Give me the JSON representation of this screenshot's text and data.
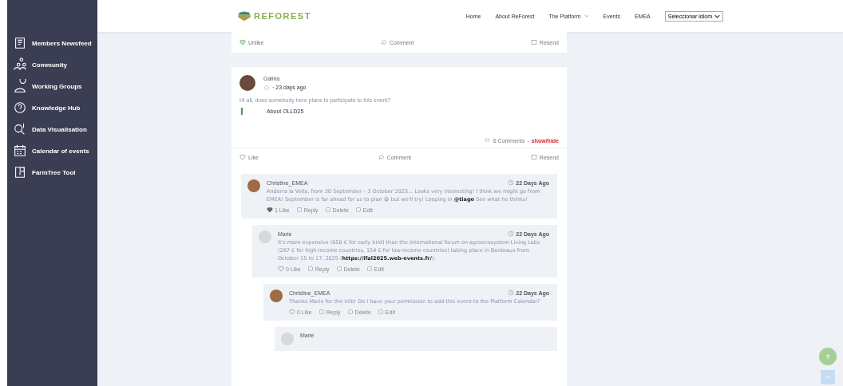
{
  "sidebar": {
    "items": [
      {
        "label": "Members Newsfeed"
      },
      {
        "label": "Community"
      },
      {
        "label": "Working Groups"
      },
      {
        "label": "Knowledge Hub"
      },
      {
        "label": "Data Visualisation"
      },
      {
        "label": "Calendar of events"
      },
      {
        "label": "FarmTree Tool"
      }
    ]
  },
  "header": {
    "logo": "REFOREST",
    "nav": [
      {
        "label": "Home",
        "dropdown": false
      },
      {
        "label": "About ReForest",
        "dropdown": false
      },
      {
        "label": "The Platform",
        "dropdown": true
      },
      {
        "label": "Events",
        "dropdown": false
      },
      {
        "label": "EMEA",
        "dropdown": false
      }
    ],
    "language_select": {
      "value": "Seleccionar idiom"
    }
  },
  "previous_post": {
    "actions": [
      {
        "label": "Unlike",
        "kind": "like",
        "liked": true
      },
      {
        "label": "Comment",
        "kind": "comment"
      },
      {
        "label": "Resend",
        "kind": "resend"
      }
    ]
  },
  "post": {
    "author": "Galina",
    "time": "· 23 days ago",
    "text": "Hi all, does somebody here plans to participate to this event?",
    "link_card": "About OLLD25",
    "comments_count": "6 Comments",
    "separator": "-",
    "toggle": "show/hide",
    "actions": [
      {
        "label": "Like",
        "kind": "like",
        "liked": false
      },
      {
        "label": "Comment",
        "kind": "comment"
      },
      {
        "label": "Resend",
        "kind": "resend"
      }
    ],
    "comments": [
      {
        "author": "Christine_EMEA",
        "has_photo": true,
        "time": "22 Days Ago",
        "text": "Andorra la Vella, from 30 September – 3 October 2025... Looks very interesting! I think we might go from EMEA! September is far ahead for us to plan 😀 but we'll try! Looping in **@tiago** See what he thinks!",
        "likes": "1 Like",
        "liked": true,
        "actions": [
          "Reply",
          "Delete",
          "Edit"
        ],
        "children": [
          {
            "author": "Marie",
            "has_photo": false,
            "time": "22 Days Ago",
            "text": "It's more expensive (650 € for early bird) than the international forum on agroecosystem Living Labs (297 € for high-income countries, 154 € for low-income countries) taking place in Bordeaux from October 15 to 17, 2025 (**https://ifal2025.web-events.fr/**).",
            "likes": "0 Like",
            "liked": false,
            "actions": [
              "Reply",
              "Delete",
              "Edit"
            ],
            "children": [
              {
                "author": "Christine_EMEA",
                "has_photo": true,
                "time": "22 Days Ago",
                "text": "Thanks Marie for the info! Do I have your permission to add this event to the Platform Calendar?",
                "likes": "0 Like",
                "liked": false,
                "actions": [
                  "Reply",
                  "Delete",
                  "Edit"
                ],
                "children": [
                  {
                    "author": "Marie",
                    "has_photo": false
                  }
                ]
              }
            ]
          }
        ]
      }
    ]
  }
}
